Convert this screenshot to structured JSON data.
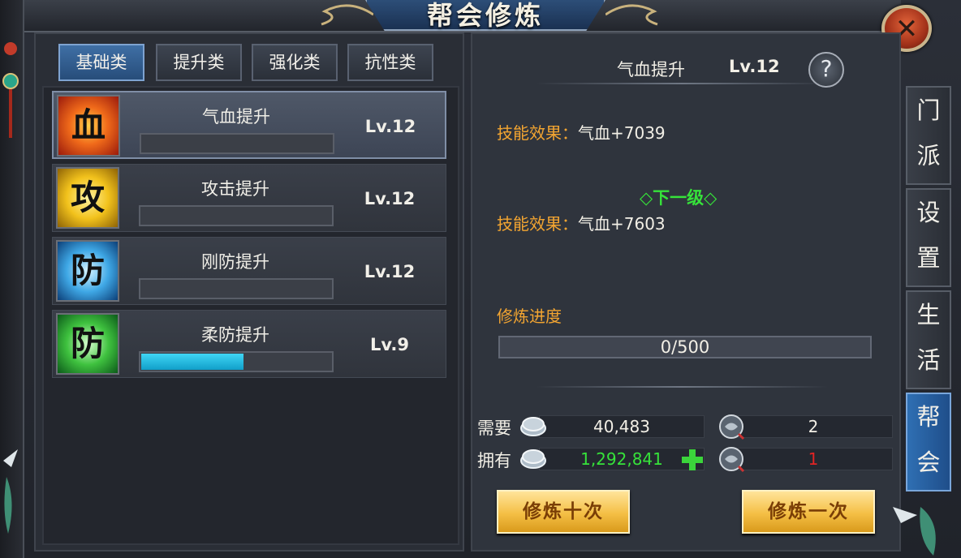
{
  "window": {
    "title": "帮会修炼",
    "close_icon": "close-icon"
  },
  "tabs": [
    {
      "label": "基础类",
      "active": true
    },
    {
      "label": "提升类",
      "active": false
    },
    {
      "label": "强化类",
      "active": false
    },
    {
      "label": "抗性类",
      "active": false
    }
  ],
  "skills": [
    {
      "name": "气血提升",
      "level": "Lv.12",
      "glyph": "血",
      "icon": "blood-icon",
      "progress": 0,
      "selected": true
    },
    {
      "name": "攻击提升",
      "level": "Lv.12",
      "glyph": "攻",
      "icon": "attack-icon",
      "progress": 0,
      "selected": false
    },
    {
      "name": "刚防提升",
      "level": "Lv.12",
      "glyph": "防",
      "icon": "hard-defense-icon",
      "progress": 0,
      "selected": false
    },
    {
      "name": "柔防提升",
      "level": "Lv.9",
      "glyph": "防",
      "icon": "soft-defense-icon",
      "progress": 0.54,
      "selected": false
    }
  ],
  "detail": {
    "name": "气血提升",
    "level": "Lv.12",
    "help_label": "?",
    "current_effect_label": "技能效果：",
    "current_effect_value": "气血+7039",
    "next_level_label": "◇下一级◇",
    "next_effect_label": "技能效果：",
    "next_effect_value": "气血+7603",
    "progress_label": "修炼进度",
    "progress_text": "0/500",
    "progress_fraction": 0
  },
  "cost": {
    "need_label": "需要",
    "have_label": "拥有",
    "need_coins": "40,483",
    "need_tokens": "2",
    "have_coins": "1,292,841",
    "have_tokens": "1",
    "colors": {
      "have_coins": "#36e23a",
      "have_tokens": "#e12424",
      "normal": "#f2efe6"
    }
  },
  "actions": {
    "train_ten": "修炼十次",
    "train_once": "修炼一次"
  },
  "side_tabs": [
    {
      "chars": [
        "门",
        "派"
      ],
      "active": false
    },
    {
      "chars": [
        "设",
        "置"
      ],
      "active": false
    },
    {
      "chars": [
        "生",
        "活"
      ],
      "active": false
    },
    {
      "chars": [
        "帮",
        "会"
      ],
      "active": true
    }
  ]
}
